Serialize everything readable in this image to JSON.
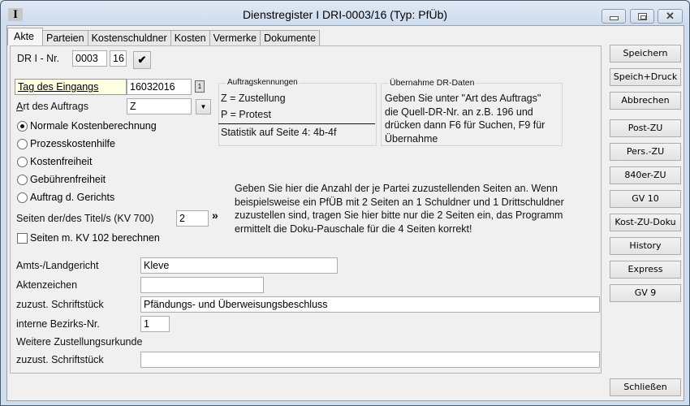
{
  "window": {
    "title": "Dienstregister I DRI-0003/16 (Typ: PfÜb)",
    "app_icon_letter": "I"
  },
  "tabs": [
    {
      "label": "Akte",
      "active": true
    },
    {
      "label": "Parteien",
      "active": false
    },
    {
      "label": "Kostenschuldner",
      "active": false
    },
    {
      "label": "Kosten",
      "active": false
    },
    {
      "label": "Vermerke",
      "active": false
    },
    {
      "label": "Dokumente",
      "active": false
    }
  ],
  "dri": {
    "label": "DR I - Nr.",
    "number": "0003",
    "year": "16",
    "confirm_icon": "checkmark-icon"
  },
  "eingang": {
    "label": "Tag des Eingangs",
    "value": "16032016",
    "calendar_icon": "calendar-icon"
  },
  "auftrag": {
    "label": "Art des Auftrags",
    "value": "Z",
    "dropdown_icon": "chevron-down-icon"
  },
  "kostenart": {
    "selected": 0,
    "options": [
      "Normale Kostenberechnung",
      "Prozesskostenhilfe",
      "Kostenfreiheit",
      "Gebührenfreiheit",
      "Auftrag d. Gerichts"
    ]
  },
  "seiten": {
    "label": "Seiten der/des Titel/s (KV 700)",
    "value": "2",
    "arrow_glyph": "»",
    "kv102_label": "Seiten m. KV 102 berechnen",
    "kv102_checked": false
  },
  "auftragskennungen": {
    "title": "Auftragskennungen",
    "lines": [
      "Z = Zustellung",
      "P = Protest"
    ],
    "statistik": "Statistik auf Seite 4: 4b-4f"
  },
  "uebernahme": {
    "title": "Übernahme DR-Daten",
    "lines": [
      "Geben Sie unter \"Art des Auftrags\"",
      "die Quell-DR-Nr. an z.B. 196 und",
      "drücken dann F6 für Suchen, F9 für",
      "Übernahme"
    ]
  },
  "hint": {
    "lines": [
      "Geben Sie hier die Anzahl der je Partei zuzustellenden Seiten an. Wenn",
      "beispielsweise ein PfÜB mit 2 Seiten an 1 Schuldner und 1 Drittschuldner",
      "zuzustellen sind, tragen Sie hier bitte nur die 2 Seiten ein, das Programm",
      "ermittelt die Doku-Pauschale für die 4 Seiten korrekt!"
    ]
  },
  "details": {
    "gericht_label": "Amts-/Landgericht",
    "gericht_value": "Kleve",
    "aktenzeichen_label": "Aktenzeichen",
    "aktenzeichen_value": "",
    "schriftstueck_label": "zuzust. Schriftstück",
    "schriftstueck_value": "Pfändungs- und Überweisungsbeschluss",
    "bezirk_label": "interne Bezirks-Nr.",
    "bezirk_value": "1",
    "weitere_label": "Weitere Zustellungsurkunde",
    "schriftstueck2_label": "zuzust. Schriftstück",
    "schriftstueck2_value": ""
  },
  "buttons": {
    "speichern": "Speichern",
    "speich_druck": "Speich+Druck",
    "abbrechen": "Abbrechen",
    "post_zu": "Post-ZU",
    "pers_zu": "Pers.-ZU",
    "zu840": "840er-ZU",
    "gv10": "GV 10",
    "kost_zu_doku": "Kost-ZU-Doku",
    "history": "History",
    "express": "Express",
    "gv9": "GV 9",
    "schliessen": "Schließen"
  }
}
